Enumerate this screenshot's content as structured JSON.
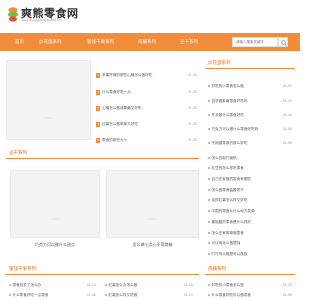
{
  "site": {
    "name": "爽熊零食网",
    "url": "www.shuangxiongling365.com"
  },
  "nav": {
    "items": [
      "首页",
      "炒花蛋系列",
      "蜜饯干果系列",
      "肉脯系列",
      "豆干系列"
    ],
    "search_placeholder": "请输入搜索关键字"
  },
  "top_section": {
    "list": [
      {
        "text": "苹果杆辣的那些山楂怎么做好吃",
        "date": "01-25"
      },
      {
        "text": "什么零食好吃一点",
        "date": "01-25"
      },
      {
        "text": "山楂怎么做成果酱又好吃",
        "date": "01-25"
      },
      {
        "text": "红薯怎么做简单又好吃",
        "date": "01-25"
      },
      {
        "text": "零食的那些大小",
        "date": "01-25"
      }
    ]
  },
  "right_panel_1": {
    "title": "炒花蛋系列",
    "items": [
      {
        "text": "好吃的小零食怎么做",
        "date": "01-03"
      },
      {
        "text": "自学做紫薯零食好吃吗",
        "date": "01-20"
      },
      {
        "text": "冬天做什么零食好吃",
        "date": "01-16"
      },
      {
        "text": "巧克力可以做什么零食好吃吗",
        "date": "01-06"
      },
      {
        "text": "不用做零食的那么好吃",
        "date": "01-06"
      }
    ]
  },
  "middle_section": {
    "title": "豆干系列",
    "cards": [
      {
        "caption": "巧克力可以做什么甜点"
      },
      {
        "caption": "怎么做小点心不用烤箱"
      }
    ]
  },
  "right_list_2": {
    "items": [
      "怎么自制打面机。",
      "红豆的怎么样吃零食",
      "自己在家做的零食有哪些",
      "怎么做零食盐酸饼干",
      "油炸红薯怎么样又好吃",
      "中国的零食从什么地方发源",
      "最饱腹的零食是什么样好",
      "怎么在家简单做零食",
      "可以用玩么做馄饨",
      "叮叮剂以锻麼可以做饭"
    ]
  },
  "bottom_left": {
    "title": "蜜饯干果系列",
    "items": [
      {
        "text": "零食批发了怎么办",
        "date": "01-13"
      },
      {
        "text": "什么零食好吃一点零食",
        "date": "01-08"
      }
    ]
  },
  "bottom_mid": {
    "items": [
      {
        "text": "红薯怎么办怎么做",
        "date": "01-18"
      },
      {
        "text": "红薯怎么样又好做",
        "date": "01-23"
      }
    ]
  },
  "bottom_right": {
    "title": "肉脯系列",
    "items": [
      {
        "text": "好吃的小零食怎么做",
        "date": "01-28"
      },
      {
        "text": "什么零食好吃可以做零食",
        "date": "01-08"
      }
    ]
  },
  "thumb_watermark": "LOGO",
  "colors": {
    "accent": "#f08c3a",
    "accent_text": "#e06a1b"
  }
}
